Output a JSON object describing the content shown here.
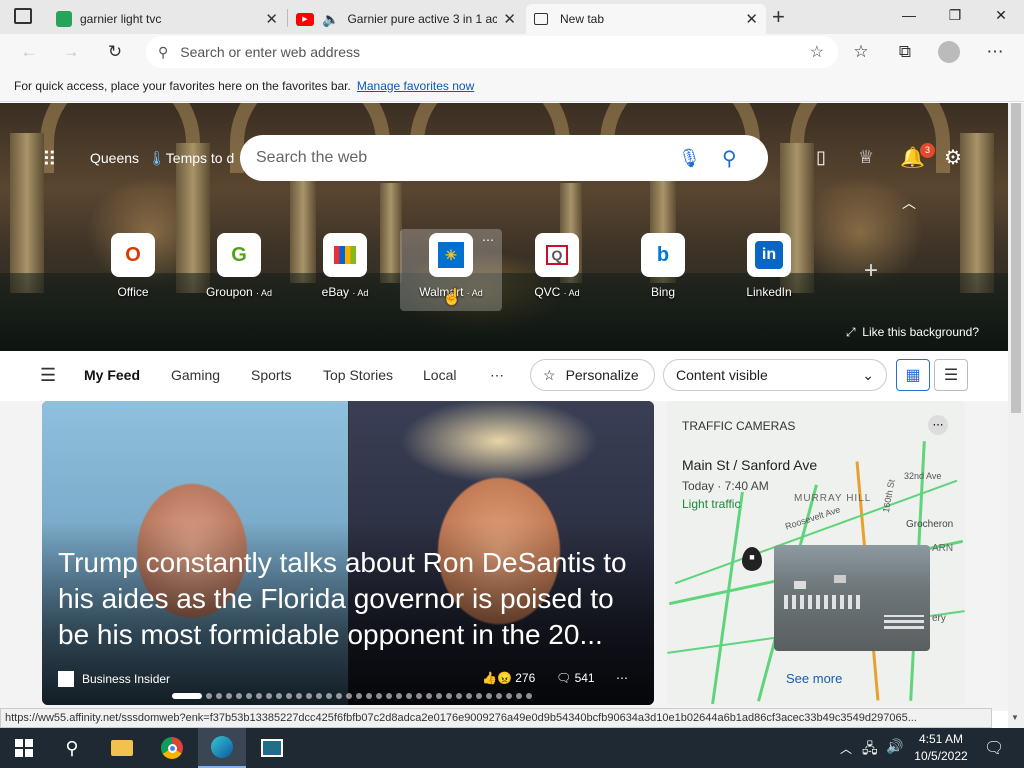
{
  "tabs": [
    {
      "title": "garnier light tvc",
      "icon": "garnier-favicon-icon"
    },
    {
      "title": "Garnier pure active 3 in 1 ac",
      "icon": "youtube-icon",
      "audio": true
    },
    {
      "title": "New tab",
      "icon": "newtab-icon",
      "active": true
    }
  ],
  "address": {
    "placeholder": "Search or enter web address"
  },
  "favbar": {
    "text": "For quick access, place your favorites here on the favorites bar.",
    "link": "Manage favorites now"
  },
  "hero": {
    "location": "Queens",
    "weather": "Temps to d",
    "search_placeholder": "Search the web",
    "notification_count": "3",
    "like_bg": "Like this background?"
  },
  "tiles": [
    {
      "label": "Office",
      "ad": "",
      "icon": "office-icon",
      "glyph": "O",
      "color": "#d83b01"
    },
    {
      "label": "Groupon",
      "ad": "· Ad",
      "icon": "groupon-icon",
      "glyph": "G",
      "color": "#53a318"
    },
    {
      "label": "eBay",
      "ad": "· Ad",
      "icon": "ebay-icon",
      "glyph": "▤",
      "color": "#e53238"
    },
    {
      "label": "Walmart",
      "ad": "· Ad",
      "icon": "walmart-icon",
      "glyph": "✳",
      "color": "#ffc220"
    },
    {
      "label": "QVC",
      "ad": "· Ad",
      "icon": "qvc-icon",
      "glyph": "Q",
      "color": "#c8102e"
    },
    {
      "label": "Bing",
      "ad": "",
      "icon": "bing-icon",
      "glyph": "b",
      "color": "#0078d4"
    },
    {
      "label": "LinkedIn",
      "ad": "",
      "icon": "linkedin-icon",
      "glyph": "in",
      "color": "#0a66c2"
    }
  ],
  "feednav": {
    "items": [
      "My Feed",
      "Gaming",
      "Sports",
      "Top Stories",
      "Local"
    ],
    "personalize": "Personalize",
    "content_visible": "Content visible"
  },
  "article": {
    "headline": "Trump constantly talks about Ron DeSantis to his aides as the Florida governor is poised to be his most formidable opponent in the 20...",
    "source": "Business Insider",
    "reactions": "276",
    "comments": "541"
  },
  "traffic": {
    "title": "TRAFFIC CAMERAS",
    "location": "Main St / Sanford Ave",
    "time": "Today · 7:40 AM",
    "status": "Light traffic",
    "see_more": "See more",
    "map_labels": [
      "MURRAY HILL",
      "Roosevelt Ave",
      "Grocheron",
      "32nd Ave",
      "160th St",
      "ARN",
      "ery"
    ]
  },
  "status_url": "https://ww55.affinity.net/sssdomweb?enk=f37b53b13385227dcc425f6fbfb07c2d8adca2e0176e9009276a49e0d9b54340bcfb90634a3d10e1b02644a6b1ad86cf3acec33b49c3549d297065...",
  "clock": {
    "time": "4:51 AM",
    "date": "10/5/2022"
  }
}
